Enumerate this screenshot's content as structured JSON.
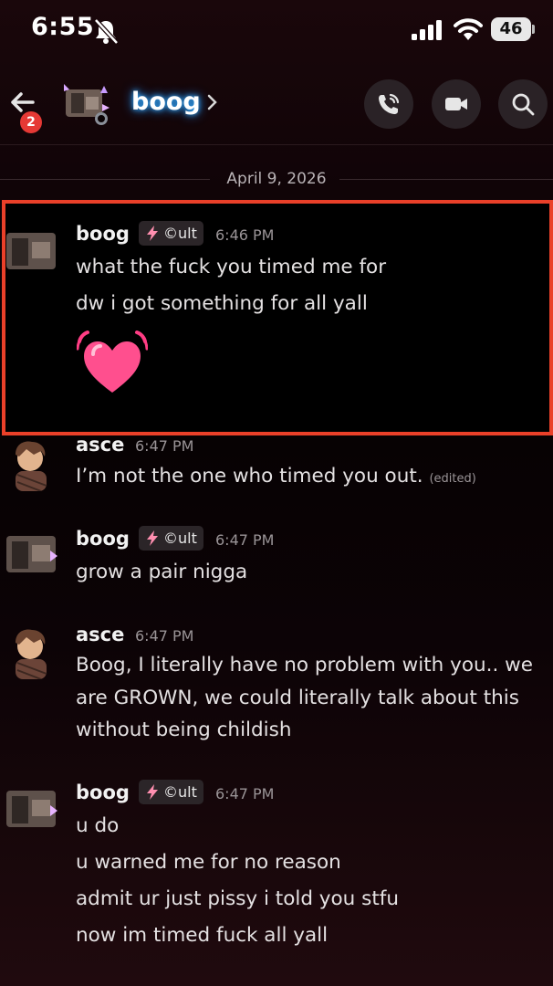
{
  "status_bar": {
    "time": "6:55",
    "battery": "46"
  },
  "header": {
    "unread_count": "2",
    "channel_name": "boog",
    "chevron": "›"
  },
  "date_separator": "April 9, 2026",
  "messages": [
    {
      "author": "boog",
      "role": "©ult",
      "time": "6:46 PM",
      "lines": [
        "what the fuck you timed me for",
        "dw i got something for all yall"
      ],
      "emoji": "heart-emoji",
      "highlighted": true
    },
    {
      "author": "asce",
      "time": "6:47 PM",
      "lines": [
        "I’m not the one who timed you out."
      ],
      "edited_label": "(edited)"
    },
    {
      "author": "boog",
      "role": "©ult",
      "time": "6:47 PM",
      "lines": [
        "grow a pair nigga"
      ]
    },
    {
      "author": "asce",
      "time": "6:47 PM",
      "lines": [
        "Boog, I literally have no problem with you.. we",
        "are GROWN, we could literally talk about this",
        "without being childish"
      ]
    },
    {
      "author": "boog",
      "role": "©ult",
      "time": "6:47 PM",
      "lines": [
        "u do",
        "u warned me for no reason",
        "admit ur just pissy i told you stfu",
        "now im timed fuck all yall"
      ]
    }
  ],
  "colors": {
    "highlight_border": "#ea4029",
    "badge": "#e53935",
    "name_glow": "#1e90ff",
    "role_bolt": "#ff8fb0"
  },
  "icons": [
    "bell-slash-icon",
    "signal-icon",
    "wifi-icon",
    "back-arrow-icon",
    "chevron-right-icon",
    "phone-call-icon",
    "video-camera-icon",
    "search-icon",
    "lightning-bolt-icon",
    "heart-emoji"
  ]
}
